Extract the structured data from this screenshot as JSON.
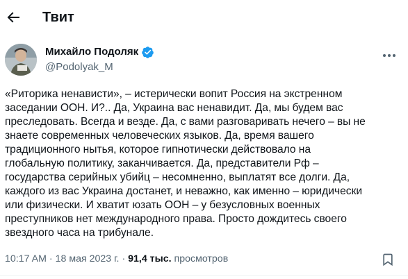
{
  "header": {
    "back_icon": "arrow-left-icon",
    "title": "Твит"
  },
  "author": {
    "name": "Михайло Подоляк",
    "handle": "@Podolyak_M",
    "verified_icon": "verified-badge-icon",
    "verified_color": "#1d9bf0",
    "more_icon": "more-horizontal-icon"
  },
  "tweet": {
    "lines": [
      "«Риторика ненависти», – истерически вопит Россия на экстренном",
      "заседании ООН. И?.. Да, Украина вас ненавидит. Да, мы будем вас",
      "преследовать. Всегда и везде. Да, с вами разговаривать нечего – вы не",
      "знаете современных человеческих языков. Да, время вашего",
      "традиционного нытья, которое гипнотически действовало на",
      "глобальную политику, заканчивается. Да, представители Рф –",
      "государства серийных убийц – несомненно, выплатят все долги. Да,",
      "каждого из вас Украина достанет, и неважно, как именно – юридически",
      "или физически. И хватит юзать ООН – у безусловных военных",
      "преступников нет международного права. Просто дождитесь своего",
      "звездного часа на трибунале."
    ]
  },
  "meta": {
    "time": "10:17 AM",
    "separator": "·",
    "date": "18 мая 2023 г.",
    "views_count": "91,4 тыс.",
    "views_label": "просмотров",
    "bookmark_icon": "bookmark-icon"
  },
  "colors": {
    "text": "#0f1419",
    "secondary_text": "#536471",
    "accent": "#1d9bf0",
    "divider": "#eff3f4"
  }
}
